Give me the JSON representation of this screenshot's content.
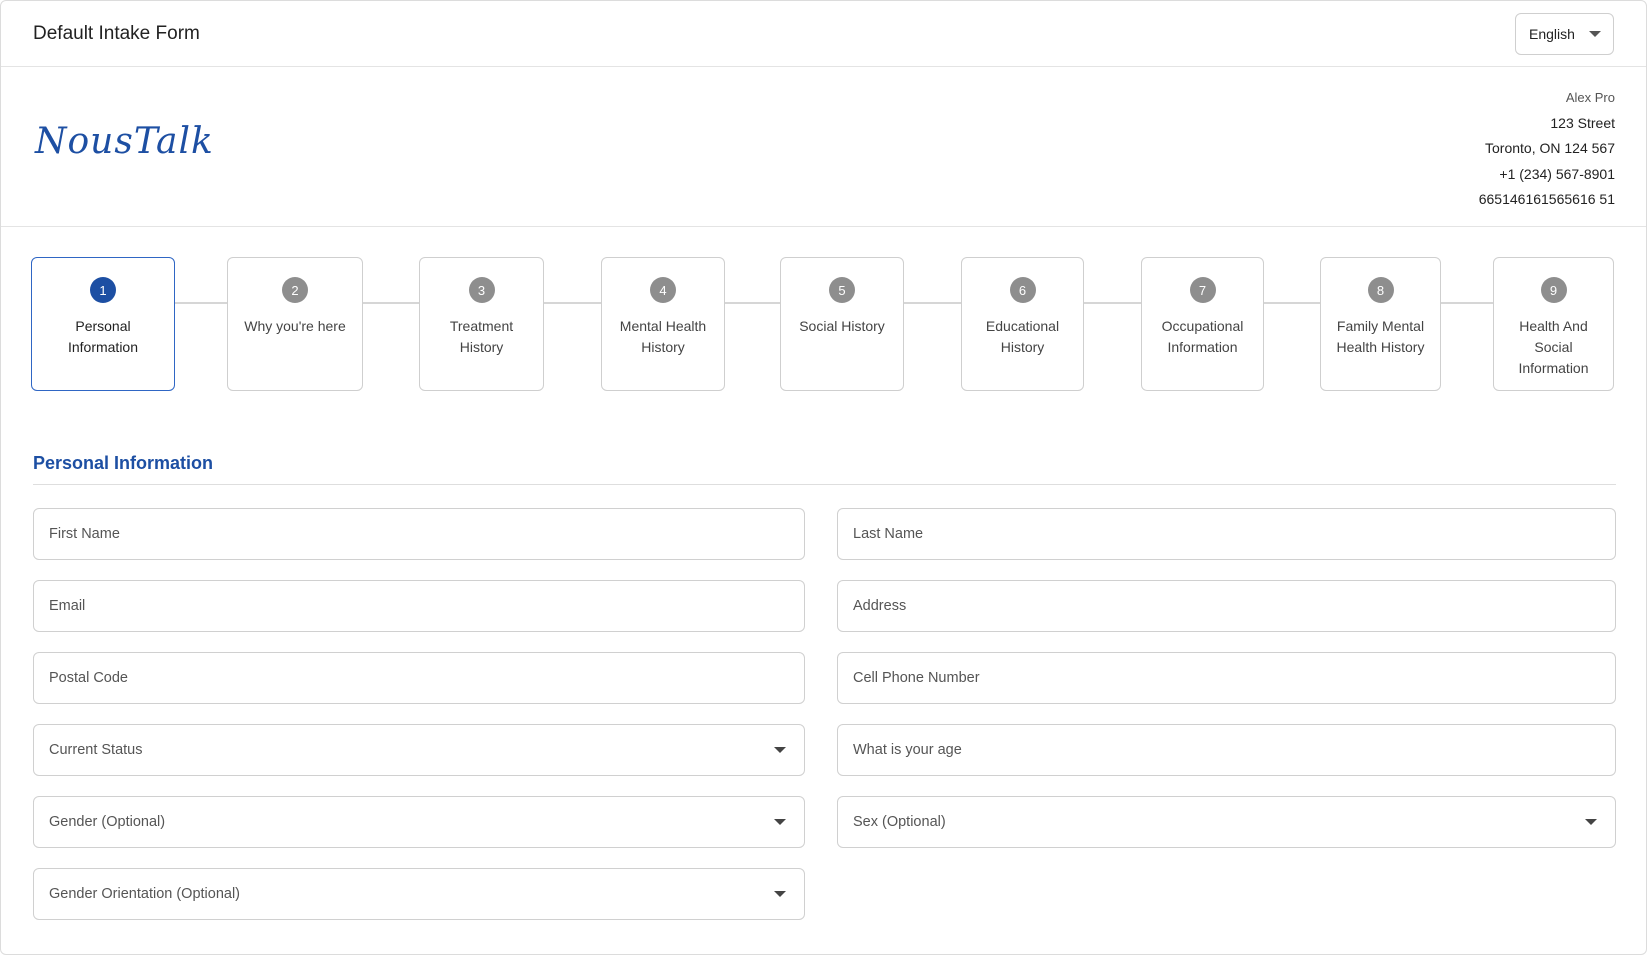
{
  "header": {
    "form_title": "Default Intake Form",
    "language": "English"
  },
  "brand": {
    "logo_text": "NousTalk",
    "accent_color": "#1d4fa3"
  },
  "contact": {
    "name": "Alex Pro",
    "street": "123 Street",
    "city": "Toronto, ON 124 567",
    "phone": "+1 (234) 567-8901",
    "id_number": "665146161565616 51"
  },
  "steps": [
    {
      "number": "1",
      "label": "Personal Information",
      "active": true
    },
    {
      "number": "2",
      "label": "Why you're here",
      "active": false
    },
    {
      "number": "3",
      "label": "Treatment History",
      "active": false
    },
    {
      "number": "4",
      "label": "Mental Health History",
      "active": false
    },
    {
      "number": "5",
      "label": "Social History",
      "active": false
    },
    {
      "number": "6",
      "label": "Educational History",
      "active": false
    },
    {
      "number": "7",
      "label": "Occupational Information",
      "active": false
    },
    {
      "number": "8",
      "label": "Family Mental Health History",
      "active": false
    },
    {
      "number": "9",
      "label": "Health And Social Information",
      "active": false
    }
  ],
  "section": {
    "title": "Personal Information"
  },
  "fields": {
    "first_name": "First Name",
    "last_name": "Last Name",
    "email": "Email",
    "address": "Address",
    "postal_code": "Postal Code",
    "cell_phone": "Cell Phone Number",
    "current_status": "Current Status",
    "age": "What is your age",
    "gender": "Gender (Optional)",
    "sex": "Sex (Optional)",
    "gender_orientation": "Gender Orientation (Optional)"
  }
}
